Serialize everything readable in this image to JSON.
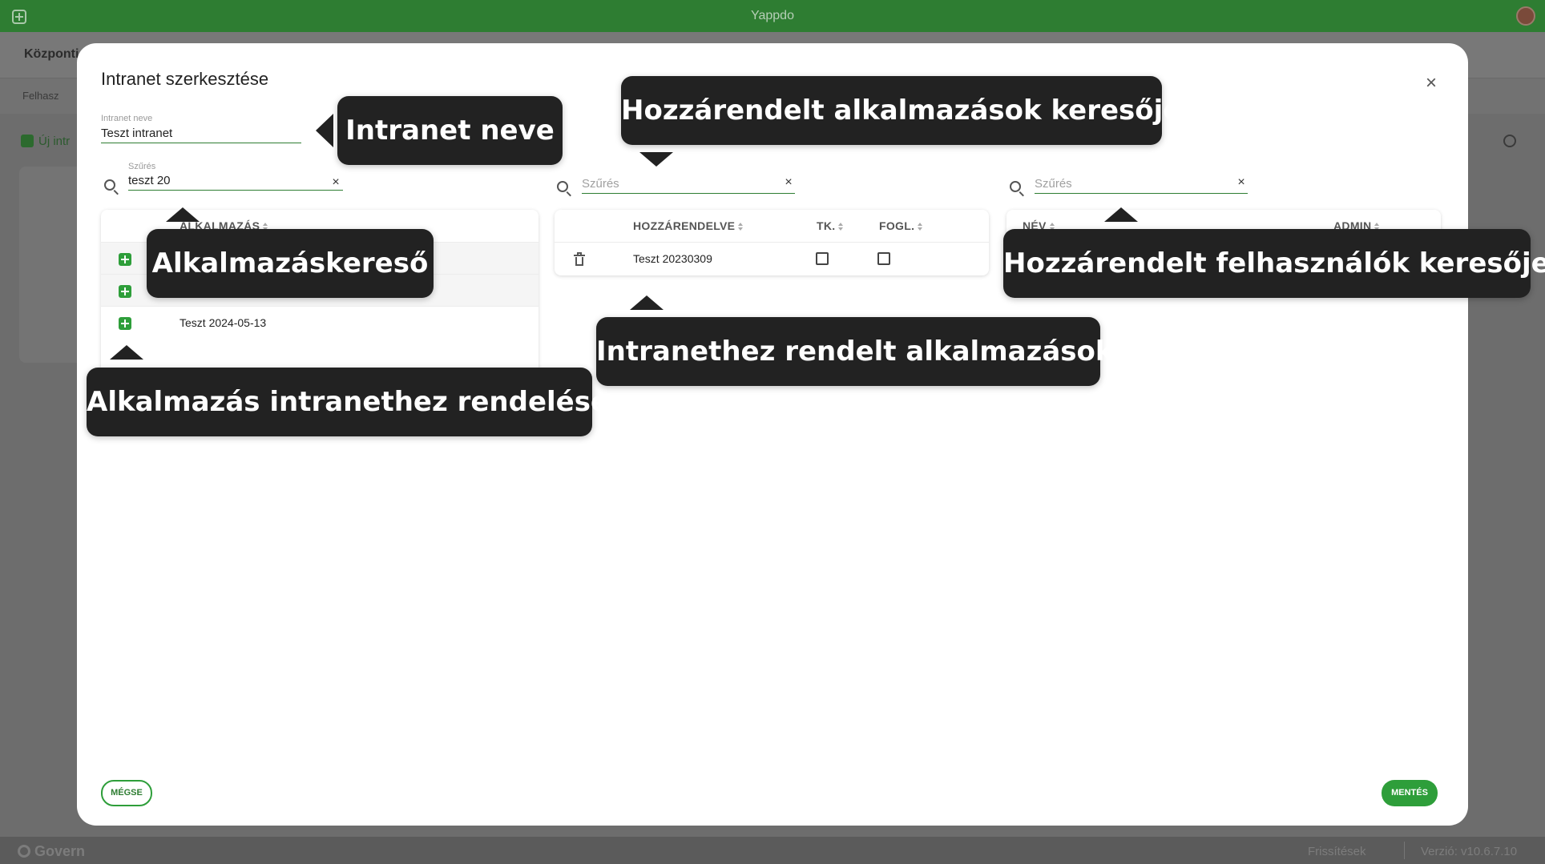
{
  "topbar": {
    "title": "Yappdo"
  },
  "background": {
    "header_title": "Központi",
    "tab_label": "Felhasz",
    "new_button": "Új intr"
  },
  "footer": {
    "brand": "Govern",
    "updates": "Frissítések",
    "version": "Verzió: v10.6.7.10"
  },
  "modal": {
    "title": "Intranet szerkesztése",
    "name_field": {
      "label": "Intranet neve",
      "value": "Teszt intranet"
    },
    "apps_search": {
      "label": "Szűrés",
      "value": "teszt 20"
    },
    "assigned_apps_search": {
      "placeholder": "Szűrés"
    },
    "assigned_users_search": {
      "placeholder": "Szűrés"
    },
    "apps_table": {
      "header": "ALKALMAZÁS",
      "rows": [
        {
          "name": ""
        },
        {
          "name": ""
        },
        {
          "name": "Teszt 2024-05-13"
        }
      ]
    },
    "assigned_apps_table": {
      "headers": {
        "assigned": "HOZZÁRENDELVE",
        "tk": "TK.",
        "fogl": "FOGL."
      },
      "rows": [
        {
          "name": "Teszt 20230309",
          "tk": false,
          "fogl": false
        }
      ]
    },
    "users_table": {
      "headers": {
        "name": "NÉV",
        "admin": "ADMIN"
      }
    },
    "cancel_label": "MÉGSE",
    "save_label": "MENTÉS"
  },
  "callouts": {
    "intranet_name": "Intranet neve",
    "assigned_apps_search": "Hozzárendelt alkalmazások keresője",
    "app_search": "Alkalmazáskereső",
    "assigned_users_search": "Hozzárendelt felhasználók keresője",
    "assigned_apps": "Intranethez rendelt alkalmazások",
    "assign_app": "Alkalmazás intranethez rendelése"
  },
  "colors": {
    "brand_green": "#2e7d32",
    "button_green": "#2e9e3a",
    "callout_bg": "#222222"
  }
}
